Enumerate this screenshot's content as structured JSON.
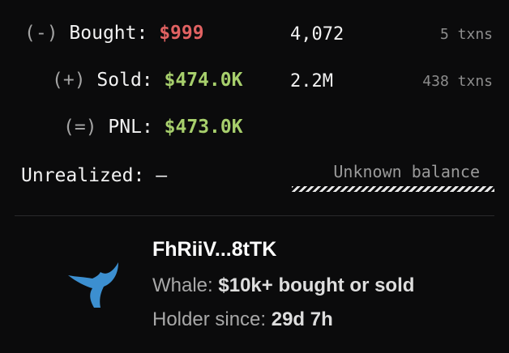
{
  "stats": {
    "bought": {
      "sign": "(-)",
      "label": "Bought:",
      "amount": "$999",
      "quantity": "4,072",
      "txns": "5 txns"
    },
    "sold": {
      "sign": "(+)",
      "label": "Sold:",
      "amount": "$474.0K",
      "quantity": "2.2M",
      "txns": "438 txns"
    },
    "pnl": {
      "sign": "(=)",
      "label": "PNL:",
      "amount": "$473.0K"
    },
    "unrealized": {
      "label": "Unrealized:",
      "value": "–",
      "balance_status": "Unknown balance"
    }
  },
  "wallet": {
    "icon": "whale-tail-icon",
    "address": "FhRiiV...8tTK",
    "whale_label": "Whale:",
    "whale_value": "$10k+ bought or sold",
    "holder_label": "Holder since:",
    "holder_value": "29d 7h"
  },
  "colors": {
    "background": "#0b0b0c",
    "negative": "#e16262",
    "positive": "#a7cf6c",
    "whale_icon": "#3c8fd0"
  }
}
